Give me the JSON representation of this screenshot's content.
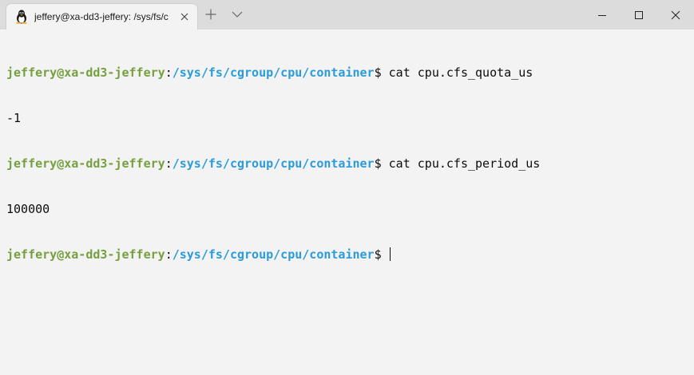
{
  "tab": {
    "title": "jeffery@xa-dd3-jeffery: /sys/fs/c",
    "icon": "linux-tux-icon"
  },
  "titlebar": {
    "new_tab_icon": "plus-icon",
    "dropdown_icon": "chevron-down-icon",
    "minimize_icon": "minimize-icon",
    "maximize_icon": "maximize-icon",
    "close_icon": "close-icon"
  },
  "colors": {
    "user": "#76a040",
    "path": "#2c9bd9",
    "text": "#0c0c0c",
    "background": "#f3f3f3"
  },
  "terminal": {
    "lines": [
      {
        "type": "prompt",
        "user": "jeffery@xa-dd3-jeffery",
        "sep": ":",
        "path": "/sys/fs/cgroup/cpu/container",
        "dollar": "$",
        "command": " cat cpu.cfs_quota_us"
      },
      {
        "type": "output",
        "text": "-1"
      },
      {
        "type": "prompt",
        "user": "jeffery@xa-dd3-jeffery",
        "sep": ":",
        "path": "/sys/fs/cgroup/cpu/container",
        "dollar": "$",
        "command": " cat cpu.cfs_period_us"
      },
      {
        "type": "output",
        "text": "100000"
      },
      {
        "type": "prompt",
        "user": "jeffery@xa-dd3-jeffery",
        "sep": ":",
        "path": "/sys/fs/cgroup/cpu/container",
        "dollar": "$",
        "command": " "
      }
    ]
  }
}
